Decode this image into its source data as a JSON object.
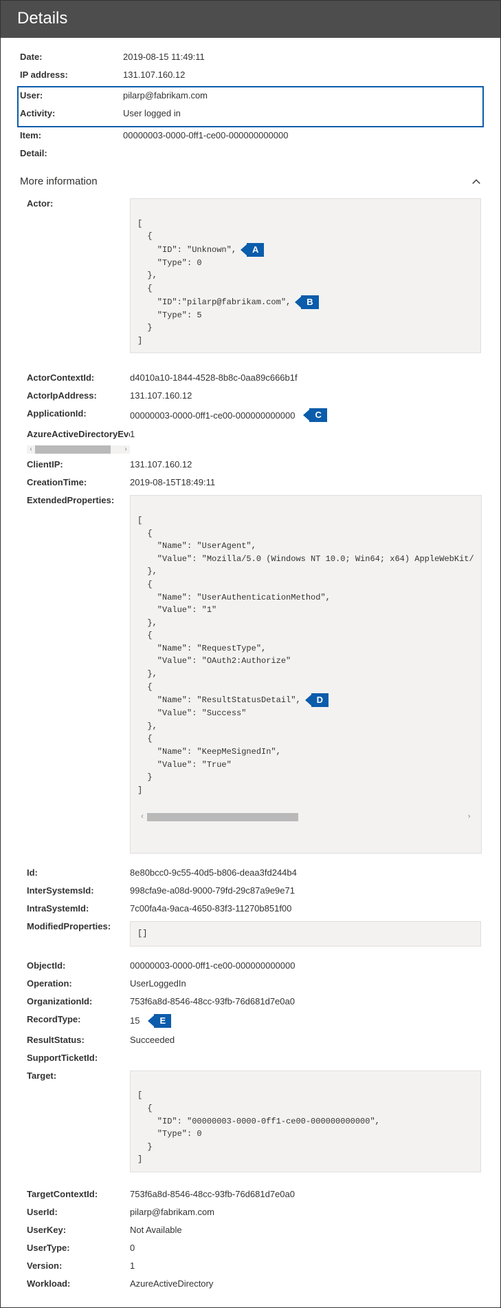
{
  "header": {
    "title": "Details"
  },
  "summary": {
    "date_label": "Date:",
    "date_value": "2019-08-15 11:49:11",
    "ip_label": "IP address:",
    "ip_value": "131.107.160.12",
    "user_label": "User:",
    "user_value": "pilarp@fabrikam.com",
    "activity_label": "Activity:",
    "activity_value": "User logged in",
    "item_label": "Item:",
    "item_value": "00000003-0000-0ff1-ce00-000000000000",
    "detail_label": "Detail:"
  },
  "more_info_title": "More information",
  "callouts": {
    "a": "A",
    "b": "B",
    "c": "C",
    "d": "D",
    "e": "E"
  },
  "mi": {
    "actor_label": "Actor:",
    "actor_code": {
      "l1": "[",
      "l2": "  {",
      "l3": "    \"ID\": \"Unknown\",",
      "l4": "    \"Type\": 0",
      "l5": "  },",
      "l6": "  {",
      "l7": "    \"ID\":\"pilarp@fabrikam.com\",",
      "l8": "    \"Type\": 5",
      "l9": "  }",
      "l10": "]"
    },
    "actorctx_label": "ActorContextId:",
    "actorctx_value": "d4010a10-1844-4528-8b8c-0aa89c666b1f",
    "actorip_label": "ActorIpAddress:",
    "actorip_value": "131.107.160.12",
    "appid_label": "ApplicationId:",
    "appid_value": "00000003-0000-0ff1-ce00-000000000000",
    "aad_label": "AzureActiveDirectoryEve",
    "aad_value": "1",
    "clientip_label": "ClientIP:",
    "clientip_value": "131.107.160.12",
    "ctime_label": "CreationTime:",
    "ctime_value": "2019-08-15T18:49:11",
    "ext_label": "ExtendedProperties:",
    "ext_code": {
      "l1": "[",
      "l2": "  {",
      "l3": "    \"Name\": \"UserAgent\",",
      "l4": "    \"Value\": \"Mozilla/5.0 (Windows NT 10.0; Win64; x64) AppleWebKit/",
      "l5": "  },",
      "l6": "  {",
      "l7": "    \"Name\": \"UserAuthenticationMethod\",",
      "l8": "    \"Value\": \"1\"",
      "l9": "  },",
      "l10": "  {",
      "l11": "    \"Name\": \"RequestType\",",
      "l12": "    \"Value\": \"OAuth2:Authorize\"",
      "l13": "  },",
      "l14": "  {",
      "l15": "    \"Name\": \"ResultStatusDetail\",",
      "l16": "    \"Value\": \"Success\"",
      "l17": "  },",
      "l18": "  {",
      "l19": "    \"Name\": \"KeepMeSignedIn\",",
      "l20": "    \"Value\": \"True\"",
      "l21": "  }",
      "l22": "]"
    },
    "id_label": "Id:",
    "id_value": "8e80bcc0-9c55-40d5-b806-deaa3fd244b4",
    "inter_label": "InterSystemsId:",
    "inter_value": "998cfa9e-a08d-9000-79fd-29c87a9e9e71",
    "intra_label": "IntraSystemId:",
    "intra_value": "7c00fa4a-9aca-4650-83f3-11270b851f00",
    "mod_label": "ModifiedProperties:",
    "mod_code": "[]",
    "objid_label": "ObjectId:",
    "objid_value": "00000003-0000-0ff1-ce00-000000000000",
    "op_label": "Operation:",
    "op_value": "UserLoggedIn",
    "org_label": "OrganizationId:",
    "org_value": "753f6a8d-8546-48cc-93fb-76d681d7e0a0",
    "rectype_label": "RecordType:",
    "rectype_value": "15",
    "result_label": "ResultStatus:",
    "result_value": "Succeeded",
    "ticket_label": "SupportTicketId:",
    "target_label": "Target:",
    "target_code": {
      "l1": "[",
      "l2": "  {",
      "l3": "    \"ID\": \"00000003-0000-0ff1-ce00-000000000000\",",
      "l4": "    \"Type\": 0",
      "l5": "  }",
      "l6": "]"
    },
    "tgtctx_label": "TargetContextId:",
    "tgtctx_value": "753f6a8d-8546-48cc-93fb-76d681d7e0a0",
    "userid_label": "UserId:",
    "userid_value": "pilarp@fabrikam.com",
    "userkey_label": "UserKey:",
    "userkey_value": "Not Available",
    "usertype_label": "UserType:",
    "usertype_value": "0",
    "version_label": "Version:",
    "version_value": "1",
    "workload_label": "Workload:",
    "workload_value": "AzureActiveDirectory"
  }
}
